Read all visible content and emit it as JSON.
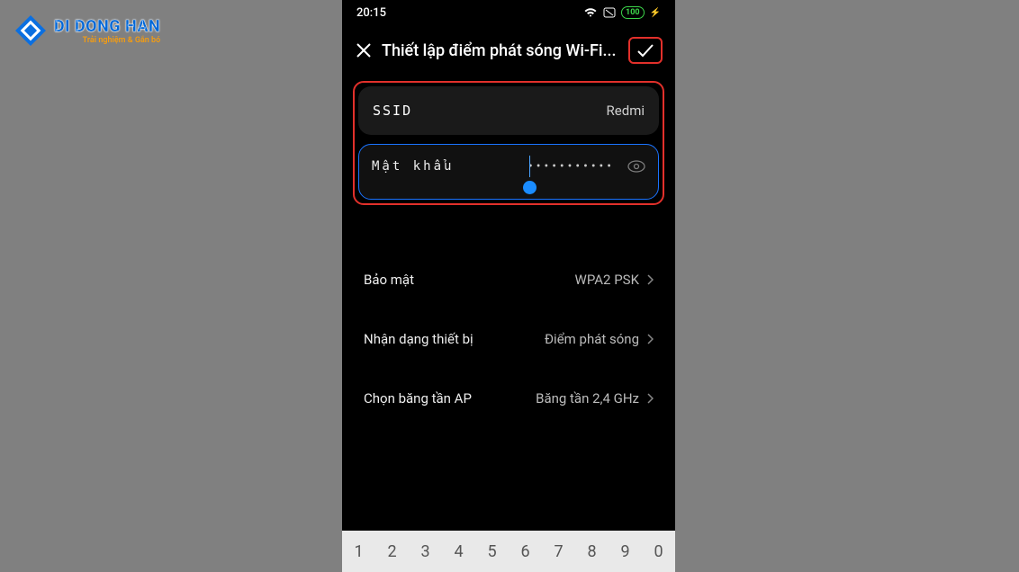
{
  "watermark": {
    "title": "DI DONG HAN",
    "subtitle": "Trải nghiệm & Gắn bó"
  },
  "statusbar": {
    "time": "20:15",
    "battery": "100"
  },
  "titlebar": {
    "title": "Thiết lập điểm phát sóng Wi-Fi..."
  },
  "ssid": {
    "label": "SSID",
    "value": "Redmi"
  },
  "password": {
    "label": "Mật khẩu",
    "masked": "•••••••••••"
  },
  "rows": {
    "security": {
      "label": "Bảo mật",
      "value": "WPA2 PSK"
    },
    "device_id": {
      "label": "Nhận dạng thiết bị",
      "value": "Điểm phát sóng"
    },
    "band": {
      "label": "Chọn băng tần AP",
      "value": "Băng tần 2,4 GHz"
    }
  },
  "keyboard": {
    "keys": [
      "1",
      "2",
      "3",
      "4",
      "5",
      "6",
      "7",
      "8",
      "9",
      "0"
    ]
  }
}
